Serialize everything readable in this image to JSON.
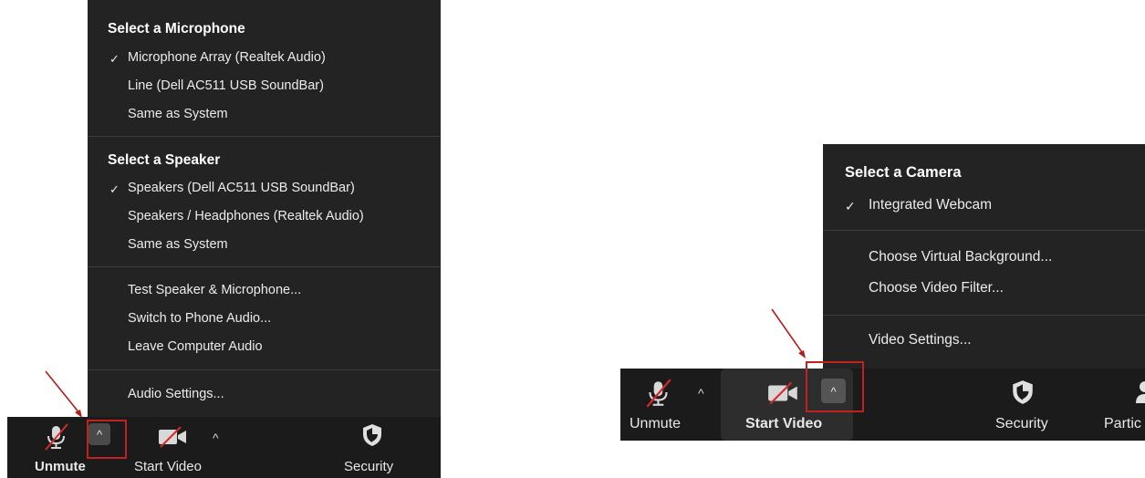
{
  "audio_menu": {
    "microphone_section": {
      "title": "Select a Microphone",
      "items": [
        {
          "label": "Microphone Array (Realtek Audio)",
          "checked": true
        },
        {
          "label": "Line (Dell AC511 USB SoundBar)",
          "checked": false
        },
        {
          "label": "Same as System",
          "checked": false
        }
      ]
    },
    "speaker_section": {
      "title": "Select a Speaker",
      "items": [
        {
          "label": "Speakers (Dell AC511 USB SoundBar)",
          "checked": true
        },
        {
          "label": "Speakers / Headphones (Realtek Audio)",
          "checked": false
        },
        {
          "label": "Same as System",
          "checked": false
        }
      ]
    },
    "actions": [
      "Test Speaker & Microphone...",
      "Switch to Phone Audio...",
      "Leave Computer Audio"
    ],
    "settings": "Audio Settings...",
    "check_mark": "✓"
  },
  "video_menu": {
    "camera_section": {
      "title": "Select a Camera",
      "items": [
        {
          "label": "Integrated Webcam",
          "checked": true
        }
      ]
    },
    "actions": [
      "Choose Virtual Background...",
      "Choose Video Filter..."
    ],
    "settings": "Video Settings...",
    "check_mark": "✓"
  },
  "toolbar_left": {
    "unmute_label": "Unmute",
    "start_video_label": "Start Video",
    "security_label": "Security",
    "caret": "^"
  },
  "toolbar_right": {
    "unmute_label": "Unmute",
    "start_video_label": "Start Video",
    "security_label": "Security",
    "participants_label": "Partic",
    "caret": "^"
  },
  "colors": {
    "menu_bg": "#232323",
    "toolbar_bg": "#1b1b1b",
    "highlight": "#c42020"
  }
}
